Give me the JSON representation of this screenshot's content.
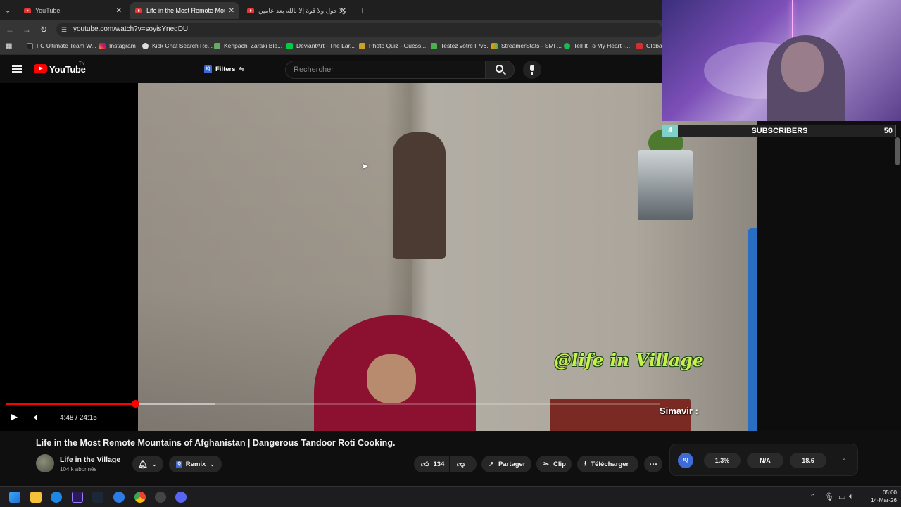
{
  "browser": {
    "tabs": [
      {
        "label": "YouTube",
        "active": false
      },
      {
        "label": "Life in the Most Remote Mount",
        "active": true
      },
      {
        "label": "ولا حول ولا قوة إلا بالله بعد عامين",
        "active": false
      }
    ],
    "new_tab": "+",
    "url": "youtube.com/watch?v=soyisYnegDU",
    "bookmarks": [
      "FC Ultimate Team W...",
      "Instagram",
      "Kick Chat Search Re...",
      "Kenpachi Zaraki Ble...",
      "DeviantArt - The Lar...",
      "Photo Quiz - Guess...",
      "Testez votre IPv6.",
      "StreamerStats - SMF...",
      "Tell It To My Heart -...",
      "Globa"
    ]
  },
  "youtube": {
    "logo_text": "YouTube",
    "logo_sup": "TN",
    "filters_label": "Filters",
    "search_placeholder": "Rechercher"
  },
  "player": {
    "watermark": "@life in Village",
    "time": "4:48 / 24:15",
    "progress_fraction": 0.198,
    "buffer_fraction": 0.32
  },
  "stream_overlay": {
    "sub_count": "4",
    "sub_label": "SUBSCRIBERS",
    "sub_goal": "50",
    "chat_user": "Simavir :"
  },
  "video_info": {
    "title": "Life in the Most Remote Mountains of Afghanistan | Dangerous Tandoor Roti Cooking.",
    "channel": "Life in the Village",
    "subscribers": "104 k abonnés",
    "remix_label": "Remix",
    "likes": "134",
    "share_label": "Partager",
    "clip_label": "Clip",
    "download_label": "Télécharger"
  },
  "iq_panel": {
    "badge": "IQ",
    "stats": [
      "1.3%",
      "N/A",
      "18.6"
    ]
  },
  "taskbar": {
    "time": "05:00",
    "date": "14-Mar-26"
  },
  "colors": {
    "yt_red": "#ff0000",
    "iq_blue": "#3e6bd6",
    "watermark_green": "#c6f04a",
    "sub_teal": "#7fd0c8"
  }
}
